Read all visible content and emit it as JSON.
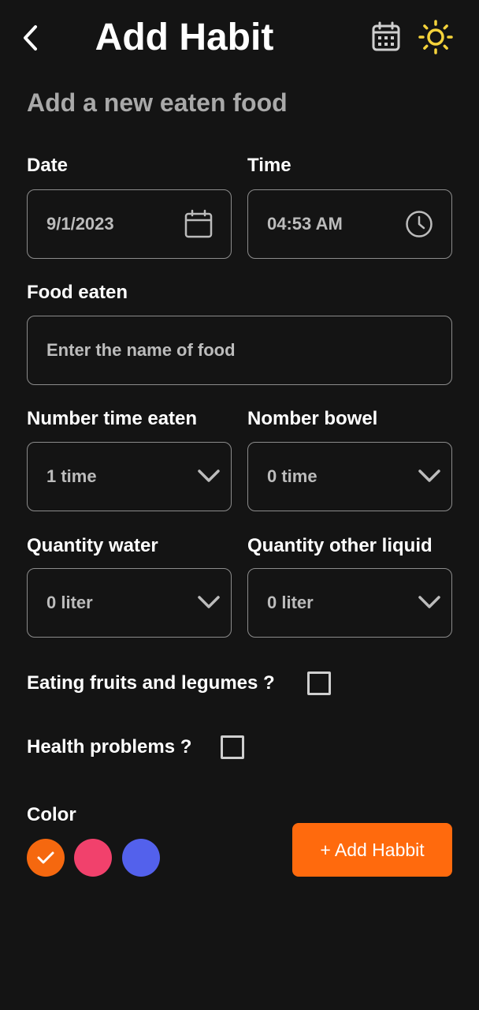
{
  "header": {
    "title": "Add Habit",
    "back_icon": "chevron-left-icon",
    "calendar_icon": "calendar-icon",
    "theme_icon": "sun-icon",
    "theme_icon_color": "#f5d33b"
  },
  "subtitle": "Add a new eaten food",
  "form": {
    "date": {
      "label": "Date",
      "value": "9/1/2023",
      "icon": "calendar-icon"
    },
    "time": {
      "label": "Time",
      "value": "04:53 AM",
      "icon": "clock-icon"
    },
    "food": {
      "label": "Food eaten",
      "placeholder": "Enter the name of food"
    },
    "times_eaten": {
      "label": "Number time eaten",
      "value": "1 time"
    },
    "bowel": {
      "label": "Nomber bowel",
      "value": "0 time"
    },
    "water": {
      "label": "Quantity water",
      "value": "0 liter"
    },
    "other_liquid": {
      "label": "Quantity other liquid",
      "value": "0 liter"
    },
    "fruits": {
      "label": "Eating fruits and legumes ?",
      "checked": false
    },
    "health": {
      "label": "Health problems ?",
      "checked": false
    }
  },
  "color": {
    "label": "Color",
    "swatches": [
      "#f5680f",
      "#f1416c",
      "#5361ec"
    ],
    "selected": 0
  },
  "submit": {
    "label": "+ Add Habbit",
    "color": "#ff6a0d"
  }
}
